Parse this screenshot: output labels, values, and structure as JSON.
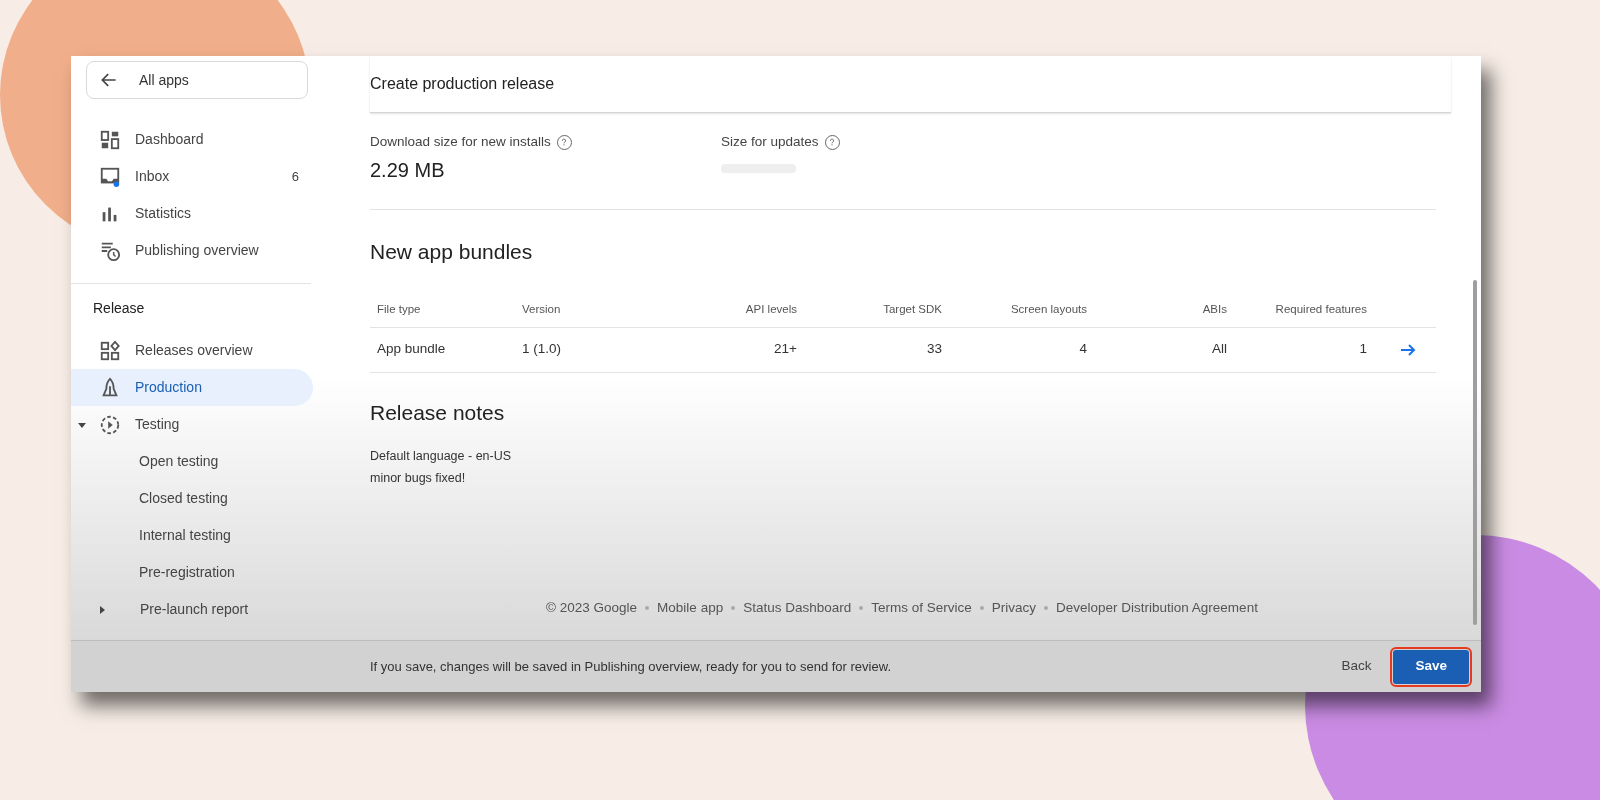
{
  "sidebar": {
    "back_link": "All apps",
    "items": [
      {
        "label": "Dashboard",
        "selected": false
      },
      {
        "label": "Inbox",
        "count": "6",
        "selected": false
      },
      {
        "label": "Statistics",
        "selected": false
      },
      {
        "label": "Publishing overview",
        "selected": false
      }
    ],
    "section_title": "Release",
    "release_items": [
      {
        "label": "Releases overview",
        "selected": false
      },
      {
        "label": "Production",
        "selected": true
      },
      {
        "label": "Testing",
        "selected": false,
        "expanded": true,
        "children": [
          {
            "label": "Open testing",
            "selected": false
          },
          {
            "label": "Closed testing",
            "selected": false
          },
          {
            "label": "Internal testing",
            "selected": false
          },
          {
            "label": "Pre-registration",
            "selected": false
          }
        ]
      },
      {
        "label": "Pre-launch report",
        "selected": false,
        "expanded": false
      }
    ]
  },
  "page": {
    "title": "Create production release",
    "sizes": [
      {
        "label": "Download size for new installs",
        "value": "2.29 MB"
      },
      {
        "label": "Size for updates"
      }
    ],
    "bundles": {
      "title": "New app bundles",
      "columns": [
        "File type",
        "Version",
        "API levels",
        "Target SDK",
        "Screen layouts",
        "ABIs",
        "Required features"
      ],
      "rows": [
        [
          "App bundle",
          "1 (1.0)",
          "21+",
          "33",
          "4",
          "All",
          "1"
        ]
      ]
    },
    "release_notes": {
      "title": "Release notes",
      "language": "Default language - en-US",
      "text": "minor bugs fixed!"
    },
    "footer_links": [
      "© 2023 Google",
      "Mobile app",
      "Status Dashboard",
      "Terms of Service",
      "Privacy",
      "Developer Distribution Agreement"
    ]
  },
  "bottom_bar": {
    "message": "If you save, changes will be saved in Publishing overview, ready for you to send for review.",
    "buttons": [
      {
        "label": "Back",
        "kind": "text",
        "highlighted": false
      },
      {
        "label": "Save",
        "kind": "filled",
        "highlighted": true
      }
    ]
  }
}
